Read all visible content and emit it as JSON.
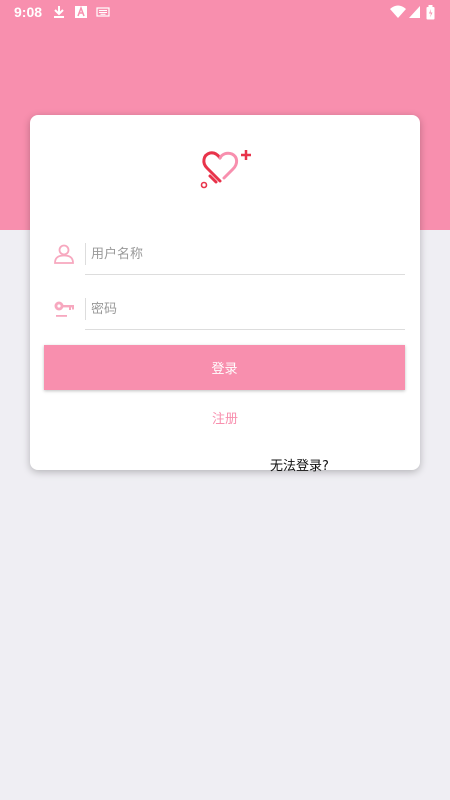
{
  "status_bar": {
    "time": "9:08"
  },
  "form": {
    "username_placeholder": "用户名称",
    "password_placeholder": "密码",
    "login_label": "登录",
    "register_label": "注册",
    "forgot_label": "无法登录?"
  },
  "colors": {
    "accent": "#f88fae",
    "logo_red": "#e8334a",
    "background": "#efeef3"
  },
  "icons": [
    "download-icon",
    "a-icon",
    "keyboard-icon",
    "wifi-icon",
    "signal-icon",
    "battery-icon",
    "heart-logo-icon",
    "user-icon",
    "key-icon"
  ]
}
